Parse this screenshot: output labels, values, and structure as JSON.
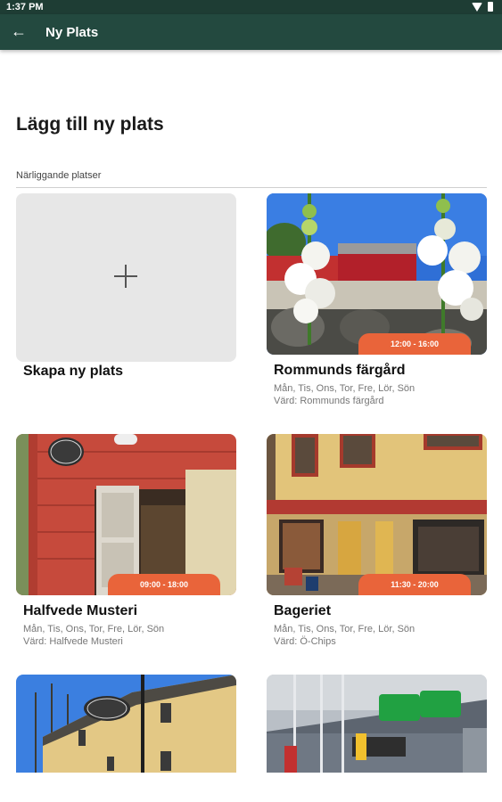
{
  "status": {
    "time": "1:37 PM"
  },
  "appbar": {
    "title": "Ny Plats",
    "back_icon": "arrow-back-icon"
  },
  "page": {
    "heading": "Lägg till ny plats",
    "section_label": "Närliggande platser"
  },
  "create": {
    "label": "Skapa ny plats",
    "icon": "plus-icon"
  },
  "places": [
    {
      "name": "Rommunds färgård",
      "hours": "12:00 - 16:00",
      "days": "Mån, Tis, Ons, Tor, Fre, Lör, Sön",
      "host": "Värd: Rommunds färgård"
    },
    {
      "name": "Halfvede Musteri",
      "hours": "09:00 - 18:00",
      "days": "Mån, Tis, Ons, Tor, Fre, Lör, Sön",
      "host": "Värd: Halfvede Musteri"
    },
    {
      "name": "Bageriet",
      "hours": "11:30 - 20:00",
      "days": "Mån, Tis, Ons, Tor, Fre, Lör, Sön",
      "host": "Värd: Ö-Chips"
    }
  ],
  "colors": {
    "appbar": "#23493f",
    "statusbar": "#1e3d34",
    "badge": "#e9643a"
  }
}
